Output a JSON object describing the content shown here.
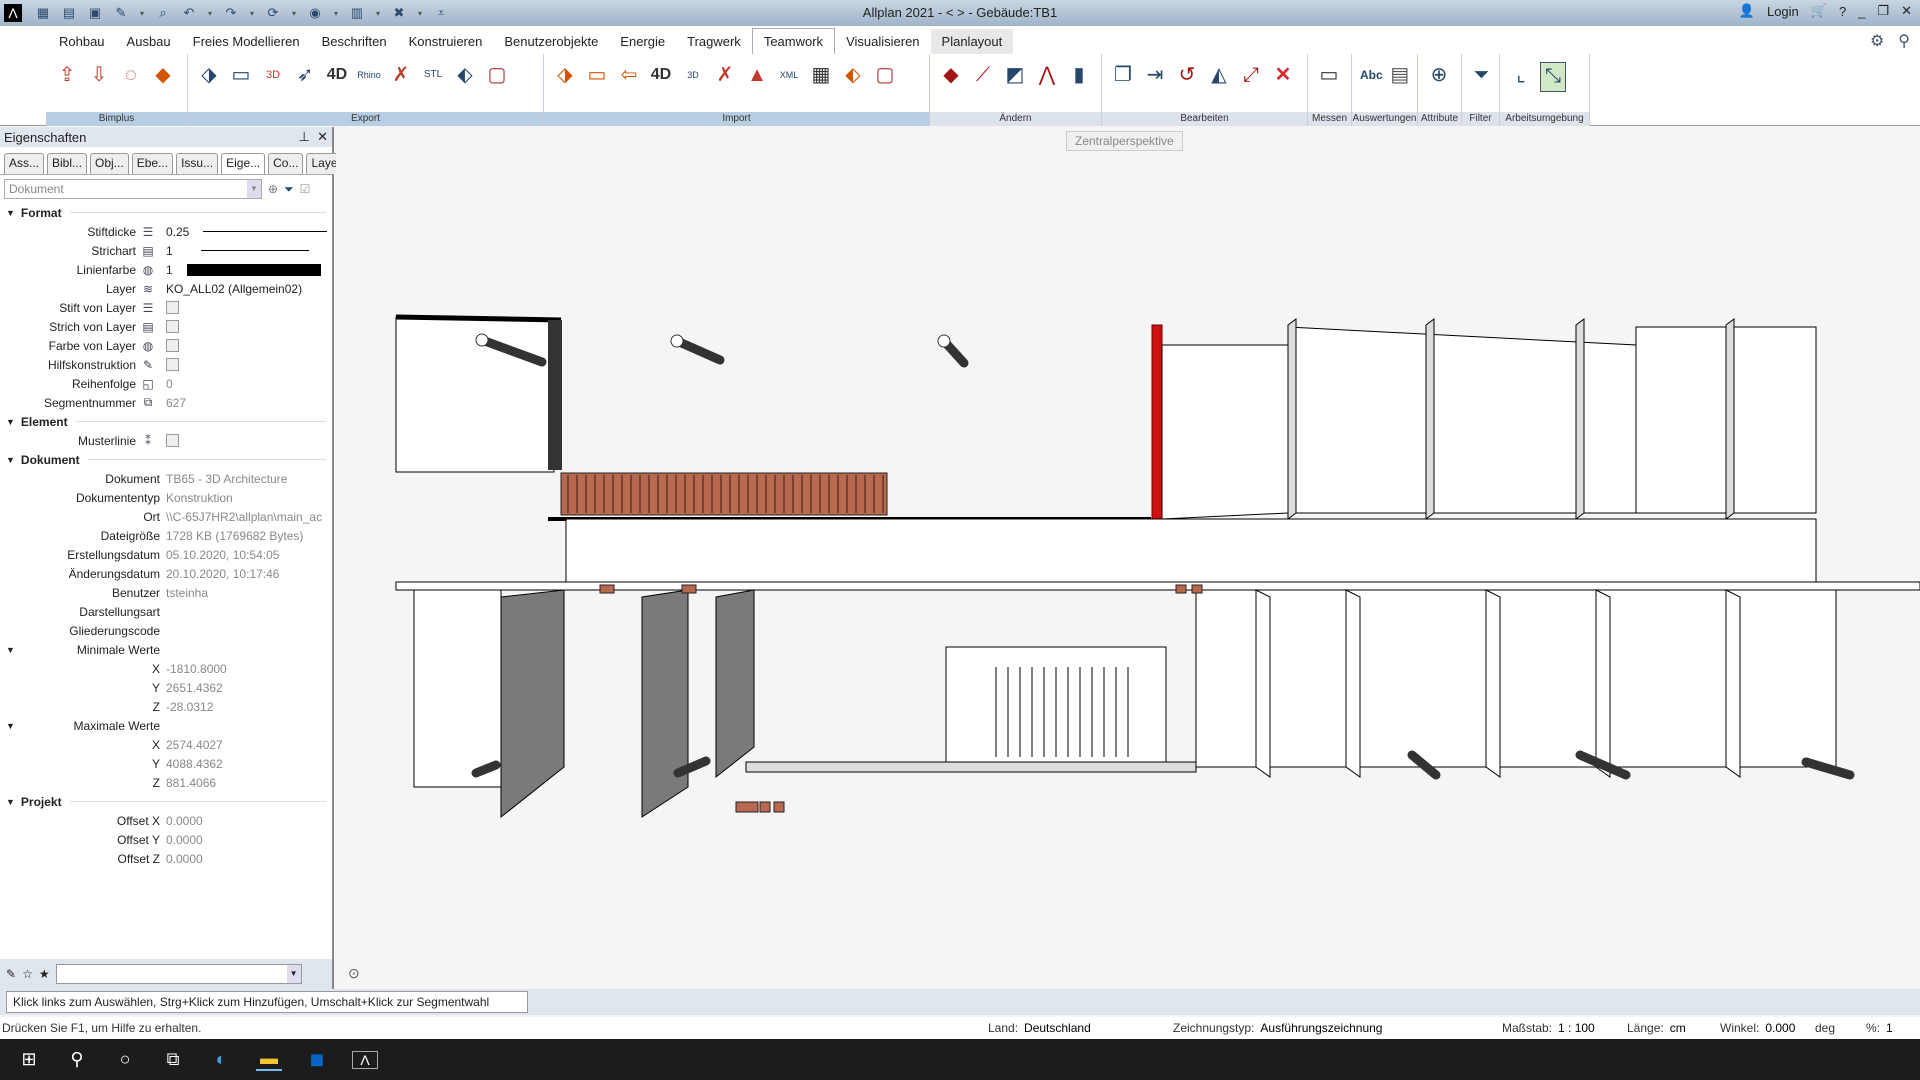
{
  "titlebar": {
    "app_icon": "allplan-logo-icon",
    "title": "Allplan 2021 - <     > - Gebäude:TB1",
    "login": "Login",
    "quick_access": [
      "open-project-icon",
      "design-entry-icon",
      "save-icon",
      "edit-icon",
      "zoom-icon",
      "undo-icon",
      "redo-icon",
      "refresh-icon",
      "visibility-icon",
      "plan-icon",
      "tools-icon",
      "customize-icon"
    ]
  },
  "menu": {
    "tabs": [
      "Rohbau",
      "Ausbau",
      "Freies Modellieren",
      "Beschriften",
      "Konstruieren",
      "Benutzerobjekte",
      "Energie",
      "Tragwerk",
      "Teamwork",
      "Visualisieren",
      "Planlayout"
    ],
    "active": "Teamwork"
  },
  "ribbon": {
    "groups": [
      {
        "label": "Bimplus",
        "icons": [
          "bimplus-upload-icon",
          "bimplus-download-icon",
          "bimplus-view-icon",
          "bimplus-tag-icon"
        ]
      },
      {
        "label": "Export",
        "icons": [
          "export-ifc-icon",
          "export-dwg-icon",
          "export-3d-pdf-icon",
          "export-acrobat-icon",
          "export-4d-icon",
          "export-rhino-icon",
          "export-sketchup-icon",
          "export-stl-icon",
          "export-attribute-icon",
          "export-cube-icon"
        ]
      },
      {
        "label": "Import",
        "icons": [
          "import-ifc-icon",
          "import-dwg-icon",
          "import-pdf-icon",
          "import-4d-icon",
          "import-rhino-icon",
          "import-sketchup-icon",
          "import-terrain-icon",
          "import-landxml-icon",
          "import-grid-icon",
          "import-attribute-icon",
          "import-cube-icon"
        ]
      },
      {
        "label": "Ändern",
        "icons": [
          "erase-icon",
          "modify-point-icon",
          "modify-element-icon",
          "modify-line-icon",
          "modify-wall-icon"
        ]
      },
      {
        "label": "Bearbeiten",
        "icons": [
          "copy-icon",
          "move-icon",
          "rotate-icon",
          "mirror-icon",
          "scale-icon",
          "delete-icon"
        ]
      },
      {
        "label": "Messen",
        "icons": [
          "ruler-icon"
        ]
      },
      {
        "label": "Auswertungen",
        "icons": [
          "text-abc-icon",
          "report-icon"
        ]
      },
      {
        "label": "Attribute",
        "icons": [
          "attribute-add-icon"
        ]
      },
      {
        "label": "Filter",
        "icons": [
          "filter-icon"
        ]
      },
      {
        "label": "Arbeitsumgebung",
        "icons": [
          "coordinate-system-icon",
          "viewport-icon"
        ]
      }
    ],
    "ribbon_text": {
      "4d": "4D",
      "rhino": "Rhino",
      "rhino3d": "3D",
      "stl": "STL",
      "xml": "XML",
      "abc": "Abc",
      "pdf3d": "3D"
    }
  },
  "panel": {
    "title": "Eigenschaften",
    "tabs": [
      "Ass...",
      "Bibl...",
      "Obj...",
      "Ebe...",
      "Issu...",
      "Eige...",
      "Co...",
      "Layer"
    ],
    "active_tab": "Eige...",
    "filter_select": "Dokument",
    "sections": {
      "format": {
        "title": "Format",
        "stiftdicke": {
          "label": "Stiftdicke",
          "value": "0.25"
        },
        "strichart": {
          "label": "Strichart",
          "value": "1"
        },
        "linienfarbe": {
          "label": "Linienfarbe",
          "value": "1",
          "color": "#000000"
        },
        "layer": {
          "label": "Layer",
          "value": "KO_ALL02 (Allgemein02)"
        },
        "stift_von_layer": {
          "label": "Stift von Layer",
          "checked": false
        },
        "strich_von_layer": {
          "label": "Strich von Layer",
          "checked": false
        },
        "farbe_von_layer": {
          "label": "Farbe von Layer",
          "checked": false
        },
        "hilfskonstruktion": {
          "label": "Hilfskonstruktion",
          "checked": false
        },
        "reihenfolge": {
          "label": "Reihenfolge",
          "value": "0"
        },
        "segmentnummer": {
          "label": "Segmentnummer",
          "value": "627"
        }
      },
      "element": {
        "title": "Element",
        "musterlinie": {
          "label": "Musterlinie",
          "checked": false
        }
      },
      "dokument": {
        "title": "Dokument",
        "dokument": {
          "label": "Dokument",
          "value": "TB65 - 3D Architecture"
        },
        "dokumententyp": {
          "label": "Dokumententyp",
          "value": "Konstruktion"
        },
        "ort": {
          "label": "Ort",
          "value": "\\\\C-65J7HR2\\allplan\\main_ac"
        },
        "dateigroesse": {
          "label": "Dateigröße",
          "value": "1728 KB (1769682 Bytes)"
        },
        "erstellungsdatum": {
          "label": "Erstellungsdatum",
          "value": "05.10.2020, 10:54:05"
        },
        "aenderungsdatum": {
          "label": "Änderungsdatum",
          "value": "20.10.2020, 10:17:46"
        },
        "benutzer": {
          "label": "Benutzer",
          "value": "tsteinha"
        },
        "darstellungsart": {
          "label": "Darstellungsart",
          "value": ""
        },
        "gliederungscode": {
          "label": "Gliederungscode",
          "value": ""
        },
        "min": {
          "label": "Minimale Werte",
          "x": "-1810.8000",
          "y": "2651.4362",
          "z": "-28.0312"
        },
        "max": {
          "label": "Maximale Werte",
          "x": "2574.4027",
          "y": "4088.4362",
          "z": "881.4066"
        },
        "axis": {
          "x": "X",
          "y": "Y",
          "z": "Z"
        }
      },
      "projekt": {
        "title": "Projekt",
        "offset_x": {
          "label": "Offset X",
          "value": "0.0000"
        },
        "offset_y": {
          "label": "Offset Y",
          "value": "0.0000"
        },
        "offset_z": {
          "label": "Offset Z",
          "value": "0.0000"
        }
      }
    },
    "bottom_input": ""
  },
  "viewport": {
    "view_label": "Zentralperspektive",
    "colors": {
      "wall": "#ffffff",
      "wall_shade": "#7a7a7a",
      "accent_red": "#d01010",
      "timber": "#b86a50",
      "outline": "#000000"
    }
  },
  "hint": "Klick links zum Auswählen, Strg+Klick zum Hinzufügen, Umschalt+Klick zur Segmentwahl",
  "status": {
    "help": "Drücken Sie F1, um Hilfe zu erhalten.",
    "land_label": "Land:",
    "land": "Deutschland",
    "zeichnungstyp_label": "Zeichnungstyp:",
    "zeichnungstyp": "Ausführungszeichnung",
    "massstab_label": "Maßstab:",
    "massstab": "1 : 100",
    "laenge_label": "Länge:",
    "laenge": "cm",
    "winkel_label": "Winkel:",
    "winkel": "0.000",
    "winkel_unit": "deg",
    "prozent_label": "%:",
    "prozent": "1"
  },
  "taskbar": [
    "windows-start-icon",
    "search-icon",
    "cortana-icon",
    "task-view-icon",
    "edge-icon",
    "file-explorer-icon",
    "outlook-icon",
    "allplan-icon"
  ]
}
